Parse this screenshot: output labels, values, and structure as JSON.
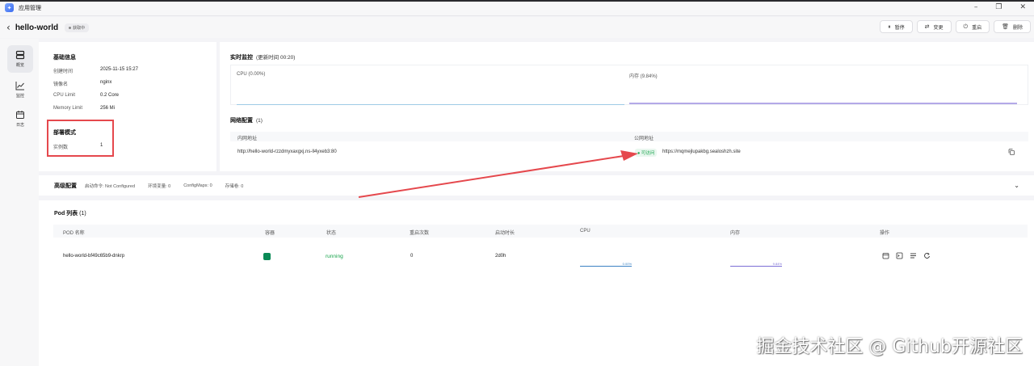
{
  "window": {
    "title": "应用管理"
  },
  "header": {
    "app_name": "hello-world",
    "status": "获取中",
    "actions": [
      {
        "label": "暂停",
        "icon": "pause-icon"
      },
      {
        "label": "变更",
        "icon": "swap-icon"
      },
      {
        "label": "重启",
        "icon": "restart-icon"
      },
      {
        "label": "删除",
        "icon": "trash-icon"
      }
    ]
  },
  "sidebar": {
    "items": [
      {
        "label": "概览",
        "icon": "overview-icon",
        "active": true
      },
      {
        "label": "监控",
        "icon": "monitor-chart-icon"
      },
      {
        "label": "日志",
        "icon": "calendar-log-icon"
      }
    ]
  },
  "basic_info": {
    "title": "基础信息",
    "rows": [
      {
        "key": "创建时间",
        "value": "2025-11-15 15:27"
      },
      {
        "key": "镜像名",
        "value": "nginx"
      },
      {
        "key": "CPU Limit",
        "value": "0.2 Core"
      },
      {
        "key": "Memory Limit",
        "value": "256 Mi"
      }
    ]
  },
  "deploy_mode": {
    "title": "部署模式",
    "rows": [
      {
        "key": "实例数",
        "value": "1"
      }
    ]
  },
  "monitor": {
    "title": "实时监控",
    "updated": "(更新时间 00:20)",
    "cpu_label": "CPU (0.00%)",
    "mem_label": "内存 (9.84%)",
    "cpu_color": "#9ecae6",
    "mem_color": "#b4a9e8"
  },
  "network": {
    "title": "网络配置",
    "count": "(1)",
    "col_internal": "内网地址",
    "col_public": "公网地址",
    "internal_address": "http://hello-world-rzzdmyxaxgxj.ns-ll4yxeb3:80",
    "access_badge": "可访问",
    "public_address": "https://mqmejlupakbg.sealoshzh.site"
  },
  "advanced": {
    "title": "高级配置",
    "items": [
      "启动命令: Not Configured",
      "环境变量: 0",
      "ConfigMaps: 0",
      "存储卷: 0"
    ]
  },
  "pods": {
    "title": "Pod 列表",
    "count": "(1)",
    "columns": [
      "POD 名称",
      "容器",
      "状态",
      "重启次数",
      "启动时长",
      "CPU",
      "内存",
      "操作"
    ],
    "rows": [
      {
        "name": "hello-world-bf49c65b9-dnkrp",
        "container_color": "#0b8a56",
        "status": "running",
        "restarts": "0",
        "uptime": "2d0h",
        "cpu": "0.00%",
        "mem": "9.84%"
      }
    ]
  },
  "watermark": "掘金技术社区 @ Github开源社区",
  "colors": {
    "accent_red": "#e5484d",
    "running_green": "#16a34a",
    "cpu_blue": "#3b82c4",
    "mem_purple": "#7c6fd6"
  }
}
